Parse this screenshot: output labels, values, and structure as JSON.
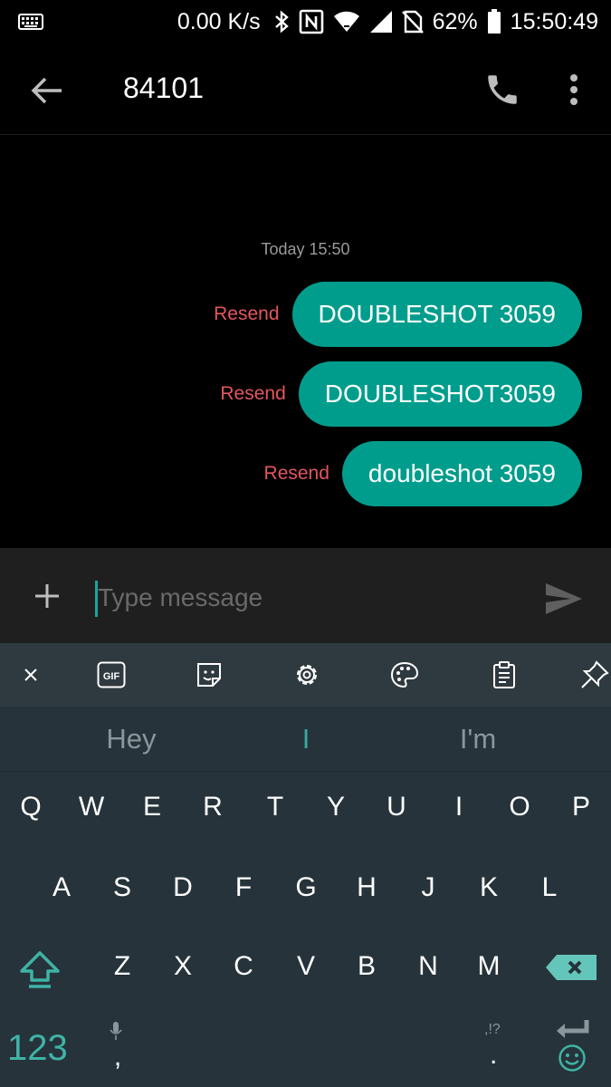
{
  "status_bar": {
    "net_speed": "0.00 K/s",
    "battery": "62%",
    "time": "15:50:49"
  },
  "app_bar": {
    "title": "84101"
  },
  "conversation": {
    "timestamp": "Today 15:50",
    "messages": [
      {
        "text": "DOUBLESHOT 3059",
        "status": "Resend"
      },
      {
        "text": "DOUBLESHOT3059",
        "status": "Resend"
      },
      {
        "text": "doubleshot 3059",
        "status": "Resend"
      }
    ]
  },
  "compose": {
    "placeholder": "Type message"
  },
  "keyboard": {
    "suggestions": [
      "Hey",
      "I",
      "I'm"
    ],
    "row1": [
      "Q",
      "W",
      "E",
      "R",
      "T",
      "Y",
      "U",
      "I",
      "O",
      "P"
    ],
    "row2": [
      "A",
      "S",
      "D",
      "F",
      "G",
      "H",
      "J",
      "K",
      "L"
    ],
    "row3": [
      "Z",
      "X",
      "C",
      "V",
      "B",
      "N",
      "M"
    ],
    "symbols_key": "123",
    "comma": ",",
    "punct_hint": ",!?",
    "period": ".",
    "gif_label": "GIF"
  },
  "colors": {
    "accent": "#009d8c",
    "error": "#e2565c",
    "keyboard_bg": "#26333a",
    "toolbar_bg": "#2f3a40"
  },
  "icons": [
    "keyboard-icon",
    "bluetooth-icon",
    "nfc-icon",
    "wifi-icon",
    "signal-icon",
    "no-sim-icon",
    "battery-icon",
    "back-arrow-icon",
    "phone-icon",
    "more-vert-icon",
    "plus-icon",
    "send-icon",
    "close-icon",
    "gif-icon",
    "sticker-icon",
    "settings-icon",
    "palette-icon",
    "clipboard-icon",
    "pin-icon",
    "shift-icon",
    "backspace-icon",
    "mic-icon",
    "enter-icon",
    "emoji-icon"
  ]
}
